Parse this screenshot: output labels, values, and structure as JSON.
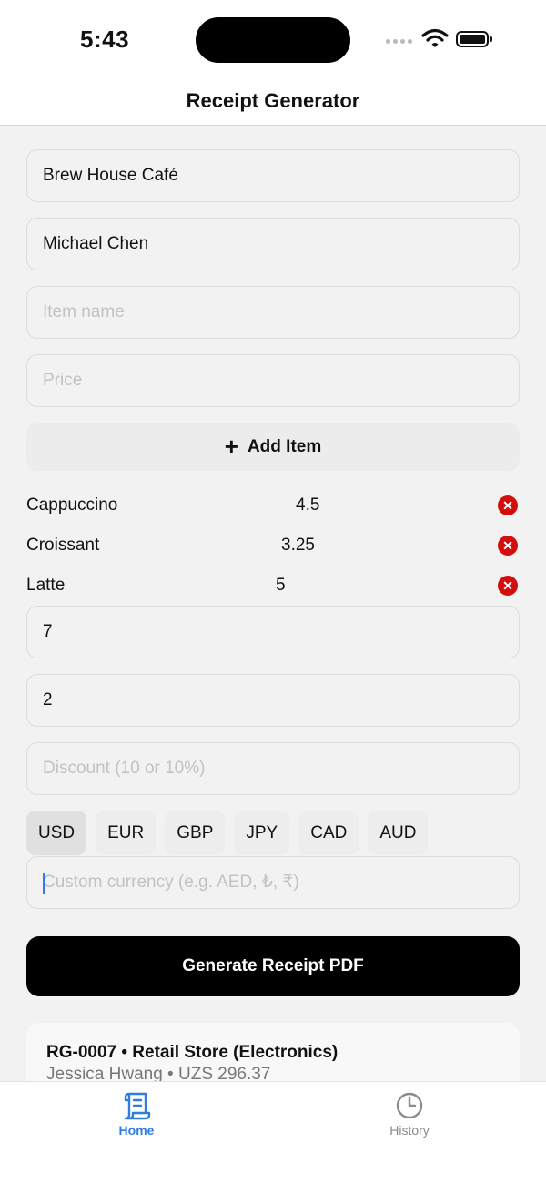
{
  "status": {
    "time": "5:43"
  },
  "nav": {
    "title": "Receipt Generator"
  },
  "form": {
    "business_name": "Brew House Café",
    "customer_name": "Michael Chen",
    "item_name_placeholder": "Item name",
    "price_placeholder": "Price",
    "add_item_label": "Add Item",
    "tax_value": "7",
    "tip_value": "2",
    "discount_placeholder": "Discount (10 or 10%)",
    "custom_currency_placeholder": "Custom currency (e.g. AED, ₺, ₹)",
    "generate_label": "Generate Receipt PDF"
  },
  "items": [
    {
      "name": "Cappuccino",
      "price": "4.5"
    },
    {
      "name": "Croissant",
      "price": "3.25"
    },
    {
      "name": "Latte",
      "price": "5"
    }
  ],
  "currencies": [
    "USD",
    "EUR",
    "GBP",
    "JPY",
    "CAD",
    "AUD"
  ],
  "selected_currency": "USD",
  "history_card": {
    "title": "RG-0007 • Retail Store (Electronics)",
    "subtitle": "Jessica Hwang • UZS 296.37"
  },
  "tabs": [
    {
      "label": "Home",
      "icon": "receipt-icon",
      "active": true
    },
    {
      "label": "History",
      "icon": "clock-icon",
      "active": false
    }
  ],
  "colors": {
    "accent": "#2f7de1",
    "remove": "#d10f0f",
    "primary_button": "#000000"
  }
}
